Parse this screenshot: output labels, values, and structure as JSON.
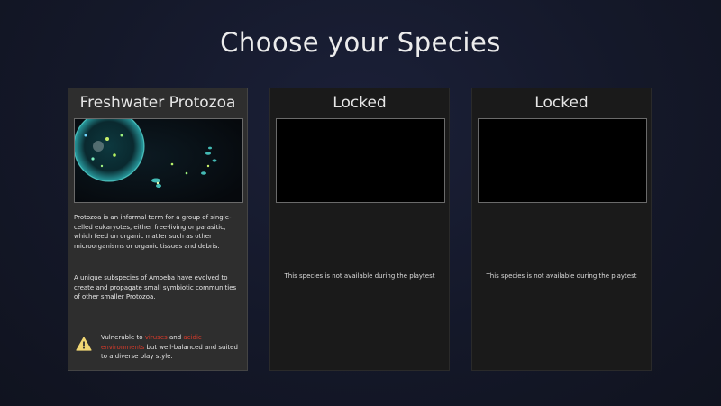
{
  "screen": {
    "title": "Choose your Species"
  },
  "cards": [
    {
      "title": "Freshwater Protozoa",
      "description_1": "Protozoa is an informal term for a group of single-celled eukaryotes, either free-living or parasitic, which feed on organic matter such as other microorganisms or organic tissues and debris.",
      "description_2": "A unique subspecies of Amoeba have evolved to create and propagate small symbiotic communities of other smaller Protozoa.",
      "warning": {
        "prefix": "Vulnerable to ",
        "hazard_1": "viruses",
        "connector": " and ",
        "hazard_2": "acidic environments",
        "suffix": " but well-balanced and suited to a diverse play style."
      },
      "icon": "warning-triangle-icon"
    },
    {
      "title": "Locked",
      "message": "This species is not available during the playtest"
    },
    {
      "title": "Locked",
      "message": "This species is not available during the playtest"
    }
  ],
  "colors": {
    "hazard_text": "#d83a2a",
    "warning_icon": "#f0d673",
    "cell_glow": "#4fd8d0"
  }
}
